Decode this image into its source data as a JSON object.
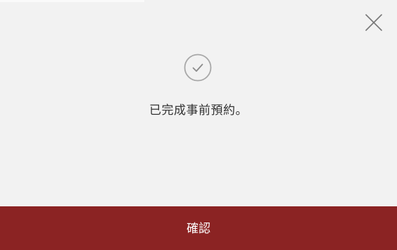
{
  "dialog": {
    "close_icon": "close-icon",
    "status_icon": "check-circle-icon",
    "message": "已完成事前預約。",
    "confirm_label": "確認",
    "colors": {
      "background": "#f2f2f2",
      "confirm_bar": "#8b2323",
      "icon": "#9a9a9a",
      "text": "#333333"
    }
  }
}
